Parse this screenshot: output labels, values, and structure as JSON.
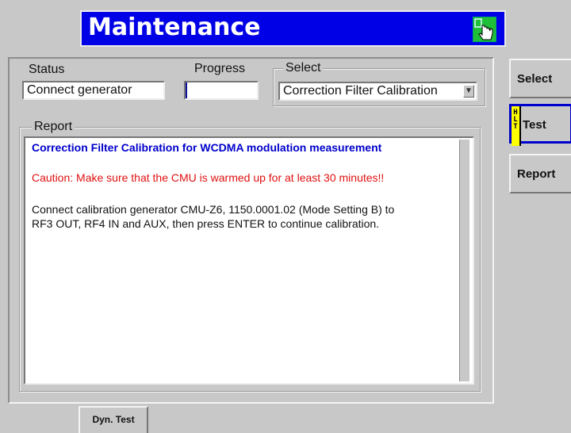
{
  "header": {
    "title": "Maintenance",
    "icon": "hand-pointer-icon"
  },
  "fields": {
    "status_label": "Status",
    "status_value": "Connect generator",
    "progress_label": "Progress",
    "progress_value": 0.02,
    "select_label": "Select",
    "select_value": "Correction Filter Calibration"
  },
  "report": {
    "label": "Report",
    "title_line": "Correction Filter Calibration for WCDMA modulation measurement",
    "caution_line": "Caution: Make sure that the CMU is warmed up for at least 30 minutes!!",
    "body_line_1": "Connect calibration generator CMU-Z6, 1150.0001.02 (Mode Setting B) to",
    "body_line_2": "RF3 OUT, RF4 IN and AUX, then press ENTER to continue calibration."
  },
  "sidebar": {
    "select_label": "Select",
    "test_label": "Test",
    "test_badge": "HLT",
    "report_label": "Report"
  },
  "tabs": {
    "dyn_test": "Dyn. Test"
  },
  "colors": {
    "title_bg": "#0000e6",
    "report_title": "#0000cc",
    "caution": "#e01010",
    "badge": "#ffff00"
  }
}
